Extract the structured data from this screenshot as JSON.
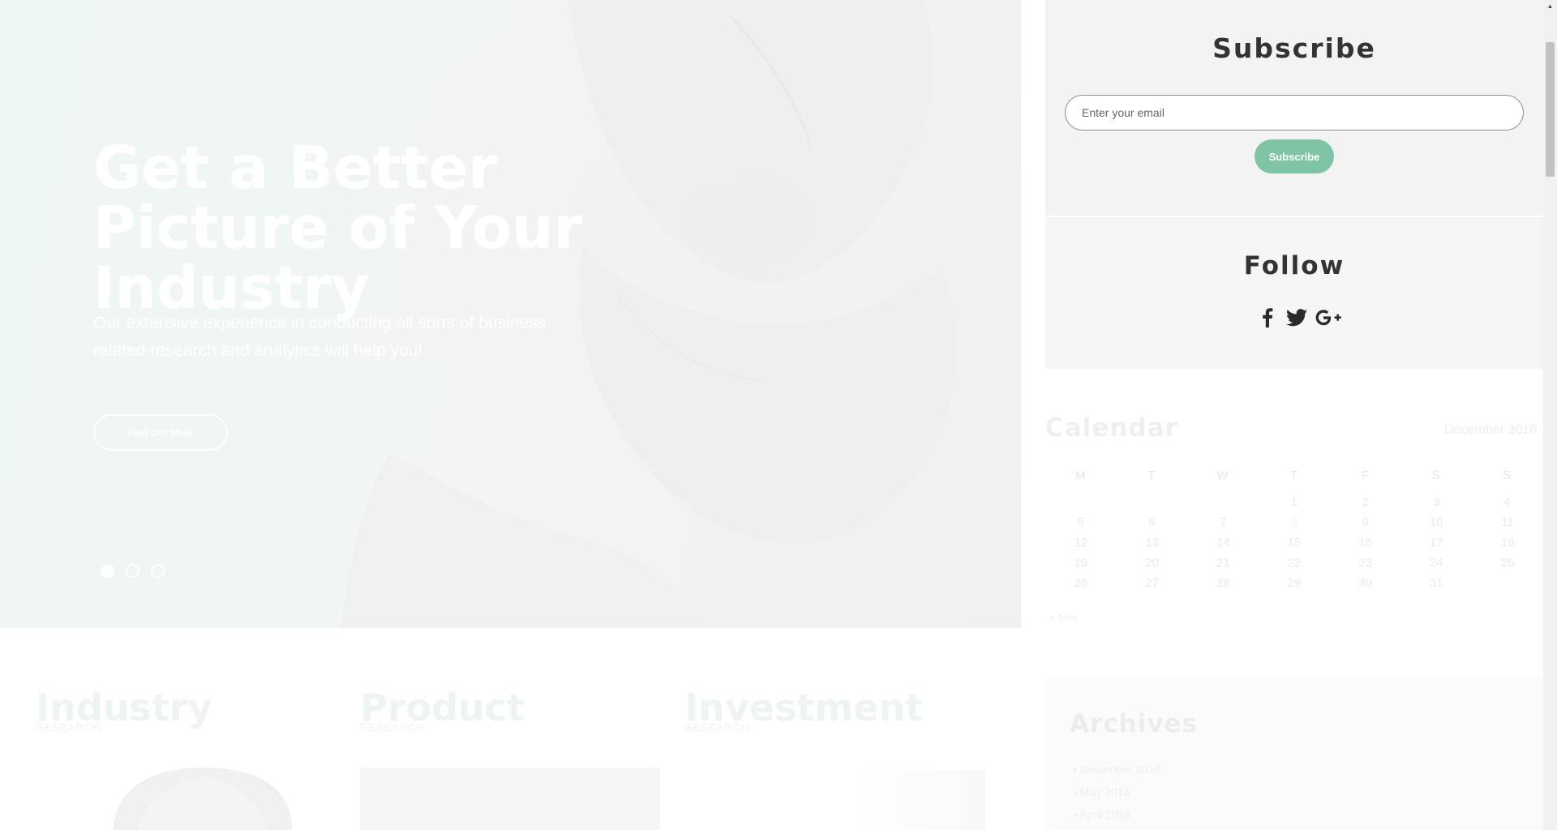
{
  "hero": {
    "title": "Get a Better Picture of Your Industry",
    "subtitle": "Our extensive experience in conducting all sorts of business related research and analytics will help you!",
    "button_label": "Find Out More",
    "slides": 3,
    "active_slide": 1
  },
  "cards": [
    {
      "title": "Industry",
      "subtitle": "RESEARCH"
    },
    {
      "title": "Product",
      "subtitle": "RESEARCH"
    },
    {
      "title": "Investment",
      "subtitle": "RESEARCH"
    }
  ],
  "subscribe": {
    "title": "Subscribe",
    "email_placeholder": "Enter your email",
    "button_label": "Subscribe",
    "accent_color": "#7fc4a4"
  },
  "follow": {
    "title": "Follow",
    "icons": [
      "facebook-icon",
      "twitter-icon",
      "google-plus-icon"
    ]
  },
  "calendar": {
    "title": "Calendar",
    "month": "December 2016",
    "weekdays": [
      "M",
      "T",
      "W",
      "T",
      "F",
      "S",
      "S"
    ],
    "weeks": [
      [
        "",
        "",
        "",
        "1",
        "2",
        "3",
        "4"
      ],
      [
        "5",
        "6",
        "7",
        "8",
        "9",
        "10",
        "11"
      ],
      [
        "12",
        "13",
        "14",
        "15",
        "16",
        "17",
        "18"
      ],
      [
        "19",
        "20",
        "21",
        "22",
        "23",
        "24",
        "25"
      ],
      [
        "26",
        "27",
        "28",
        "29",
        "30",
        "31",
        ""
      ]
    ],
    "prev_link": "« Nov"
  },
  "archives": {
    "title": "Archives",
    "items": [
      "November 2016",
      "May 2016",
      "April 2016"
    ]
  }
}
